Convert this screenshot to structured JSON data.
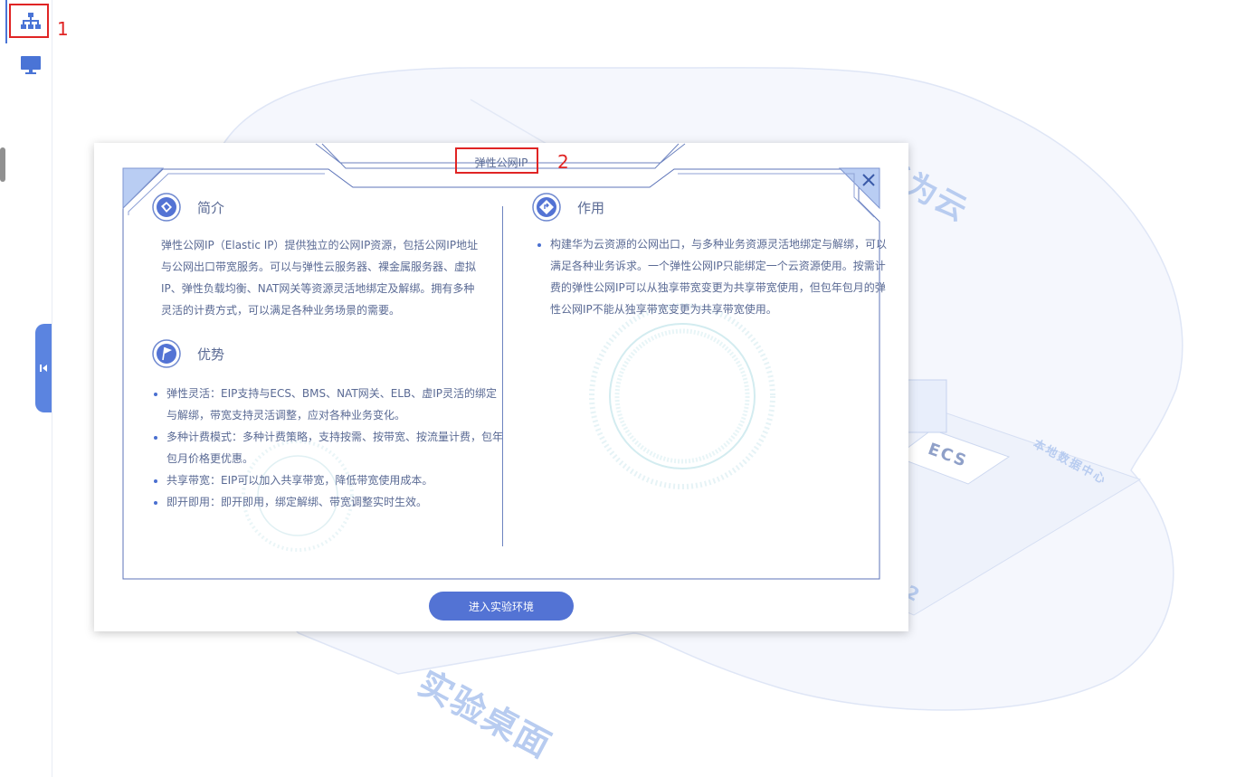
{
  "annotations": {
    "mark1": "1",
    "mark2": "2"
  },
  "background": {
    "label_huawei": "华为云",
    "label_desktop": "实验桌面",
    "label_ecs": "ECS",
    "label_local_dc": "本地数据中心",
    "label_c2": "2"
  },
  "modal": {
    "title": "弹性公网IP",
    "intro_heading": "简介",
    "intro_text": "弹性公网IP（Elastic IP）提供独立的公网IP资源，包括公网IP地址与公网出口带宽服务。可以与弹性云服务器、裸金属服务器、虚拟IP、弹性负载均衡、NAT网关等资源灵活地绑定及解绑。拥有多种灵活的计费方式，可以满足各种业务场景的需要。",
    "adv_heading": "优势",
    "adv_items": [
      "弹性灵活：EIP支持与ECS、BMS、NAT网关、ELB、虚IP灵活的绑定与解绑，带宽支持灵活调整，应对各种业务变化。",
      "多种计费模式：多种计费策略，支持按需、按带宽、按流量计费，包年包月价格更优惠。",
      "共享带宽：EIP可以加入共享带宽，降低带宽使用成本。",
      "即开即用：即开即用，绑定解绑、带宽调整实时生效。"
    ],
    "func_heading": "作用",
    "func_items": [
      "构建华为云资源的公网出口，与多种业务资源灵活地绑定与解绑，可以满足各种业务诉求。一个弹性公网IP只能绑定一个云资源使用。按需计费的弹性公网IP可以从独享带宽变更为共享带宽使用，但包年包月的弹性公网IP不能从独享带宽变更为共享带宽使用。"
    ],
    "enter_button": "进入实验环境"
  },
  "icons": {
    "topology": "topology-icon",
    "desktop": "monitor-icon",
    "collapse": "collapse-left-icon",
    "close": "close-icon",
    "intro": "document-icon",
    "advantage": "flag-icon",
    "function": "signpost-icon"
  },
  "colors": {
    "accent": "#5373d4",
    "sidebar_accent": "#4a74d6",
    "annotation": "#e02424",
    "background_art": "#f3f6fd"
  }
}
